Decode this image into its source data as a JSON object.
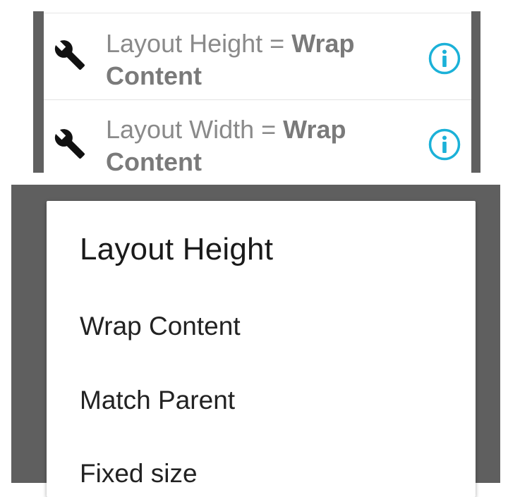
{
  "properties": [
    {
      "name_label": "Layout Height",
      "separator": " = ",
      "value_line1": "Wrap",
      "value_line2": "Content",
      "edit_icon": "wrench-icon",
      "info_icon": "info-icon"
    },
    {
      "name_label": "Layout Width",
      "separator": " = ",
      "value_line1": "Wrap",
      "value_line2": "Content",
      "edit_icon": "wrench-icon",
      "info_icon": "info-icon"
    }
  ],
  "dialog": {
    "title": "Layout Height",
    "options": [
      {
        "label": "Wrap Content"
      },
      {
        "label": "Match Parent"
      },
      {
        "label": "Fixed size"
      }
    ]
  },
  "colors": {
    "accent_info": "#1bb1d8",
    "scrim": "#5f5f5f",
    "panel_edge": "#606060",
    "property_text": "#8a8a8a"
  }
}
